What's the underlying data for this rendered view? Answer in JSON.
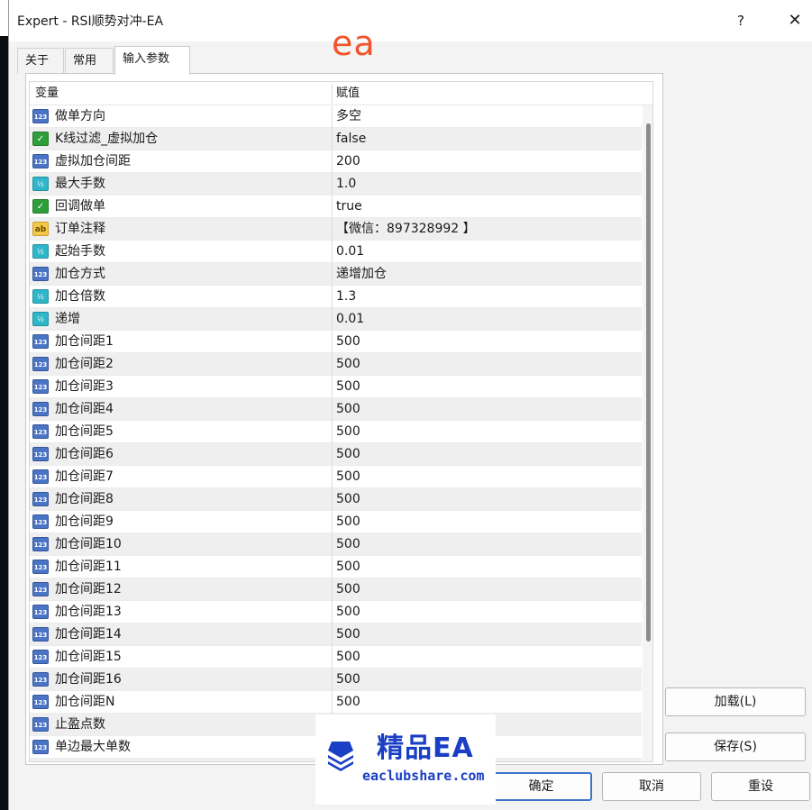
{
  "window": {
    "title": "Expert - RSI顺势对冲-EA",
    "help_label": "?",
    "close_label": "✕"
  },
  "overlay_mark": "ea",
  "tabs": [
    {
      "label": "关于"
    },
    {
      "label": "常用"
    },
    {
      "label": "输入参数",
      "active": true
    }
  ],
  "grid": {
    "headers": {
      "name": "变量",
      "value": "赋值"
    },
    "rows": [
      {
        "type": "int",
        "icon_text": "123",
        "name": "做单方向",
        "value": "多空"
      },
      {
        "type": "bool",
        "icon_text": "✓",
        "name": "K线过滤_虚拟加仓",
        "value": "false"
      },
      {
        "type": "int",
        "icon_text": "123",
        "name": "虚拟加仓间距",
        "value": "200"
      },
      {
        "type": "dbl",
        "icon_text": "½",
        "name": "最大手数",
        "value": "1.0"
      },
      {
        "type": "bool",
        "icon_text": "✓",
        "name": "回调做单",
        "value": "true"
      },
      {
        "type": "str",
        "icon_text": "ab",
        "name": "订单注释",
        "value": "【微信：897328992 】"
      },
      {
        "type": "dbl",
        "icon_text": "½",
        "name": "起始手数",
        "value": "0.01"
      },
      {
        "type": "int",
        "icon_text": "123",
        "name": "加仓方式",
        "value": "递增加仓"
      },
      {
        "type": "dbl",
        "icon_text": "½",
        "name": "加仓倍数",
        "value": "1.3"
      },
      {
        "type": "dbl",
        "icon_text": "½",
        "name": "递增",
        "value": "0.01"
      },
      {
        "type": "int",
        "icon_text": "123",
        "name": "加仓间距1",
        "value": "500"
      },
      {
        "type": "int",
        "icon_text": "123",
        "name": "加仓间距2",
        "value": "500"
      },
      {
        "type": "int",
        "icon_text": "123",
        "name": "加仓间距3",
        "value": "500"
      },
      {
        "type": "int",
        "icon_text": "123",
        "name": "加仓间距4",
        "value": "500"
      },
      {
        "type": "int",
        "icon_text": "123",
        "name": "加仓间距5",
        "value": "500"
      },
      {
        "type": "int",
        "icon_text": "123",
        "name": "加仓间距6",
        "value": "500"
      },
      {
        "type": "int",
        "icon_text": "123",
        "name": "加仓间距7",
        "value": "500"
      },
      {
        "type": "int",
        "icon_text": "123",
        "name": "加仓间距8",
        "value": "500"
      },
      {
        "type": "int",
        "icon_text": "123",
        "name": "加仓间距9",
        "value": "500"
      },
      {
        "type": "int",
        "icon_text": "123",
        "name": "加仓间距10",
        "value": "500"
      },
      {
        "type": "int",
        "icon_text": "123",
        "name": "加仓间距11",
        "value": "500"
      },
      {
        "type": "int",
        "icon_text": "123",
        "name": "加仓间距12",
        "value": "500"
      },
      {
        "type": "int",
        "icon_text": "123",
        "name": "加仓间距13",
        "value": "500"
      },
      {
        "type": "int",
        "icon_text": "123",
        "name": "加仓间距14",
        "value": "500"
      },
      {
        "type": "int",
        "icon_text": "123",
        "name": "加仓间距15",
        "value": "500"
      },
      {
        "type": "int",
        "icon_text": "123",
        "name": "加仓间距16",
        "value": "500"
      },
      {
        "type": "int",
        "icon_text": "123",
        "name": "加仓间距N",
        "value": "500"
      },
      {
        "type": "int",
        "icon_text": "123",
        "name": "止盈点数",
        "value": ""
      },
      {
        "type": "int",
        "icon_text": "123",
        "name": "单边最大单数",
        "value": ""
      },
      {
        "type": "bool",
        "icon_text": "✓",
        "name": "",
        "value": ""
      }
    ]
  },
  "buttons": {
    "load": "加载(L)",
    "save": "保存(S)",
    "ok": "确定",
    "cancel": "取消",
    "reset": "重设"
  },
  "watermark": {
    "title": "精品EA",
    "url": "eaclubshare.com"
  },
  "colors": {
    "accent": "#3c74c8",
    "int_icon": "#4a74c4",
    "bool_icon": "#2e9e3a",
    "double_icon": "#2eb6c9",
    "string_icon": "#f2c846",
    "overlay_mark": "#f0542a",
    "watermark": "#1a3ec4"
  }
}
